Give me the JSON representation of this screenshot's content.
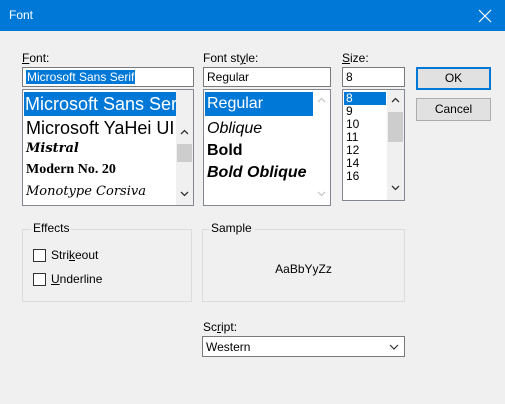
{
  "window": {
    "title": "Font"
  },
  "font": {
    "label_hotkey": "F",
    "label_rest": "ont:",
    "value": "Microsoft Sans Serif",
    "items": [
      "Microsoft Sans Serif",
      "Microsoft YaHei UI",
      "Mistral",
      "Modern No. 20",
      "Monotype Corsiva"
    ]
  },
  "style": {
    "label_pre": "Font st",
    "label_hotkey": "y",
    "label_rest": "le:",
    "value": "Regular",
    "items": [
      "Regular",
      "Oblique",
      "Bold",
      "Bold Oblique"
    ]
  },
  "size": {
    "label_hotkey": "S",
    "label_rest": "ize:",
    "value": "8",
    "items": [
      "8",
      "9",
      "10",
      "11",
      "12",
      "14",
      "16"
    ]
  },
  "buttons": {
    "ok": "OK",
    "cancel": "Cancel"
  },
  "effects": {
    "label": "Effects",
    "strikeout_pre": "Stri",
    "strikeout_hotkey": "k",
    "strikeout_rest": "eout",
    "underline_hotkey": "U",
    "underline_rest": "nderline"
  },
  "sample": {
    "label": "Sample",
    "text": "AaBbYyZz"
  },
  "script": {
    "label_pre": "Sc",
    "label_hotkey": "r",
    "label_rest": "ipt:",
    "value": "Western"
  },
  "colors": {
    "accent": "#0078d7",
    "face": "#f0f0f0"
  }
}
